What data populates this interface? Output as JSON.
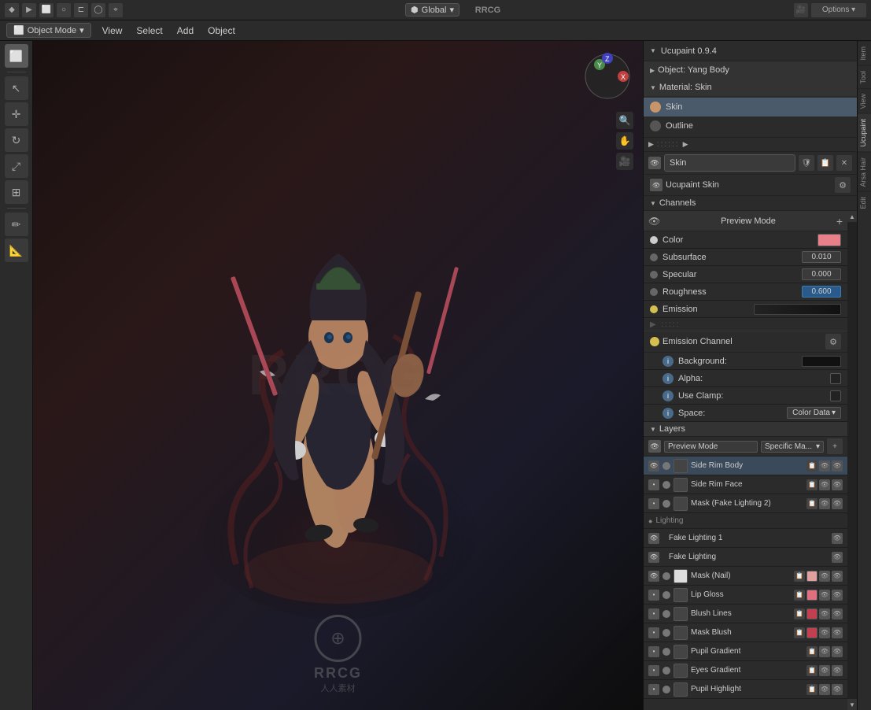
{
  "topbar": {
    "mode_icon": "◆",
    "select_label": "Select",
    "global_label": "Global",
    "global_dropdown": "▾",
    "logo_text": "RRCG",
    "options_label": "Options ▾"
  },
  "secondbar": {
    "mode_label": "Object Mode",
    "menu_items": [
      "View",
      "Select",
      "Add",
      "Object"
    ]
  },
  "left_tools": {
    "tools": [
      {
        "name": "select-box",
        "icon": "⬜"
      },
      {
        "name": "cursor",
        "icon": "↖"
      },
      {
        "name": "move",
        "icon": "✛"
      },
      {
        "name": "rotate",
        "icon": "↻"
      },
      {
        "name": "scale",
        "icon": "⤢"
      },
      {
        "name": "transform",
        "icon": "⊞"
      },
      {
        "name": "annotate",
        "icon": "✏"
      },
      {
        "name": "measure",
        "icon": "📐"
      }
    ]
  },
  "right_panel": {
    "header": {
      "title": "Ucupaint 0.9.4",
      "object_label": "Object: Yang Body",
      "material_label": "Material: Skin"
    },
    "materials": [
      {
        "name": "Skin",
        "dot": "skin",
        "selected": true
      },
      {
        "name": "Outline",
        "dot": "outline",
        "selected": false
      }
    ],
    "skin_name": "Skin",
    "ucupaint_label": "Ucupaint Skin",
    "channels": {
      "label": "Channels",
      "preview_mode": "Preview Mode",
      "properties": [
        {
          "label": "Color",
          "dot": "white",
          "value_type": "swatch",
          "swatch": "pink"
        },
        {
          "label": "Subsurface",
          "dot": "gray",
          "value": "0.010"
        },
        {
          "label": "Specular",
          "dot": "gray",
          "value": "0.000"
        },
        {
          "label": "Roughness",
          "dot": "gray",
          "value": "0.600",
          "value_style": "blue"
        },
        {
          "label": "Emission",
          "dot": "yellow",
          "value_type": "bar"
        }
      ]
    },
    "emission_channel": {
      "label": "Emission Channel",
      "background_label": "Background:",
      "alpha_label": "Alpha:",
      "use_clamp_label": "Use Clamp:",
      "space_label": "Space:",
      "space_value": "Color Data"
    },
    "layers": {
      "label": "Layers",
      "mode_label": "Preview Mode",
      "specific_ma": "Specific Ma...",
      "items": [
        {
          "name": "Side Rim Body",
          "has_icons": true,
          "selected": true,
          "eye": true
        },
        {
          "name": "Side Rim Face",
          "has_icons": true,
          "selected": false,
          "eye": false
        },
        {
          "name": "Mask (Fake Lighting 2)",
          "has_icons": true,
          "selected": false,
          "eye": false
        },
        {
          "name": "Fake Lighting 1",
          "has_icons": false,
          "selected": false,
          "eye": true,
          "lighting": true
        },
        {
          "name": "Fake Lighting",
          "has_icons": false,
          "selected": false,
          "eye": true,
          "lighting": true
        },
        {
          "name": "Mask (Nail)",
          "has_icons": true,
          "selected": false,
          "eye": true,
          "has_swatch": true,
          "swatch": "#ddd"
        },
        {
          "name": "Lip Gloss",
          "has_icons": true,
          "selected": false,
          "eye": false,
          "has_swatch": true,
          "swatch": "#e07080"
        },
        {
          "name": "Blush Lines",
          "has_icons": true,
          "selected": false,
          "eye": false,
          "has_swatch": true,
          "swatch": "#c04050"
        },
        {
          "name": "Mask Blush",
          "has_icons": true,
          "selected": false,
          "eye": false,
          "has_swatch": true,
          "swatch": "#c04050"
        },
        {
          "name": "Pupil Gradient",
          "has_icons": true,
          "selected": false,
          "eye": false
        },
        {
          "name": "Eyes Gradient",
          "has_icons": true,
          "selected": false,
          "eye": false
        },
        {
          "name": "Pupil Highlight",
          "has_icons": true,
          "selected": false,
          "eye": false
        }
      ]
    },
    "side_tabs": [
      "Item",
      "Tool",
      "View",
      "Ucupaint",
      "Arsa Hair",
      "Edit"
    ]
  }
}
